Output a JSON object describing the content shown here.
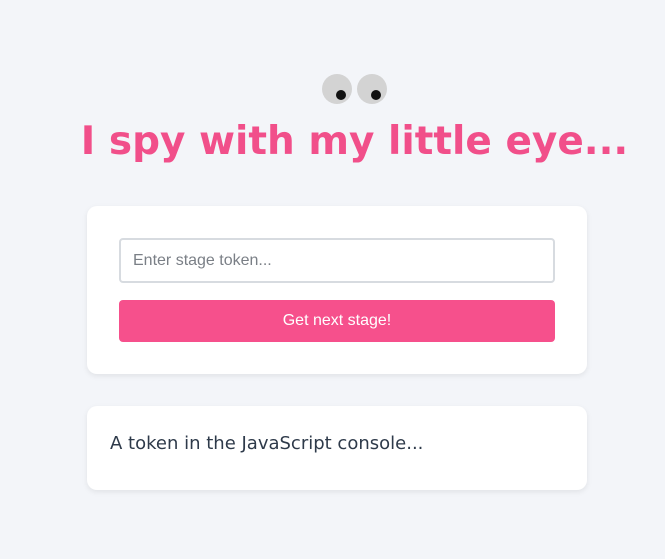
{
  "header": {
    "title": "I spy with my little eye..."
  },
  "form": {
    "token_placeholder": "Enter stage token...",
    "token_value": "",
    "submit_label": "Get next stage!"
  },
  "info": {
    "hint": "A token in the JavaScript console..."
  },
  "colors": {
    "accent": "#f6508c",
    "title": "#f14f8a",
    "background": "#f3f5f9"
  },
  "icons": {
    "eyes": "googly-eyes-icon"
  }
}
